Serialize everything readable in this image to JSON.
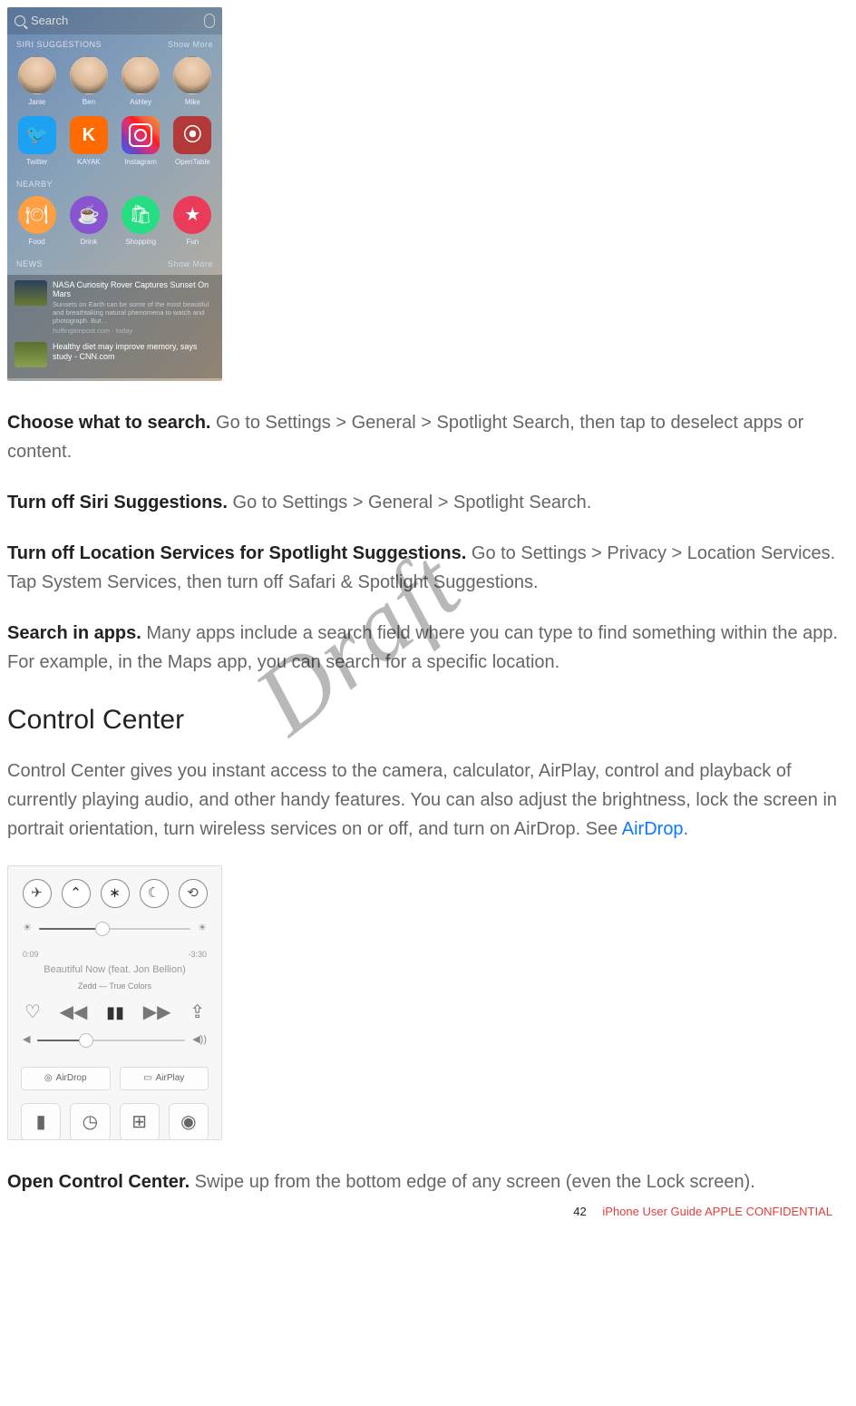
{
  "shot1": {
    "search_placeholder": "Search",
    "section_siri": "SIRI SUGGESTIONS",
    "section_nearby": "NEARBY",
    "section_news": "NEWS",
    "show_more": "Show More",
    "people": [
      "Janie",
      "Ben",
      "Ashley",
      "Mike"
    ],
    "apps": [
      "Twitter",
      "KAYAK",
      "Instagram",
      "OpenTable"
    ],
    "nearby": [
      "Food",
      "Drink",
      "Shopping",
      "Fun"
    ],
    "news1_title": "NASA Curiosity Rover Captures Sunset On Mars",
    "news1_sub": "Sunsets on Earth can be some of the most beautiful and breathtaking natural phenomena to watch and photograph. But…",
    "news1_src": "huffingtonpost.com · today",
    "news2_title": "Healthy diet may improve memory, says study - CNN.com"
  },
  "p1_bold": "Choose what to search.",
  "p1_rest": " Go to Settings > General > Spotlight Search, then tap to deselect apps or content.",
  "p2_bold": "Turn off Siri Suggestions.",
  "p2_rest": " Go to Settings > General > Spotlight Search.",
  "p3_bold": "Turn off Location Services for Spotlight Suggestions.",
  "p3_rest": " Go to Settings > Privacy > Location Services. Tap System Services, then turn off Safari & Spotlight Suggestions.",
  "p4_bold": "Search in apps.",
  "p4_rest": " Many apps include a search field where you can type to find something within the app. For example, in the Maps app, you can search for a specific location.",
  "h2": "Control Center",
  "p5_a": "Control Center gives you instant access to the camera, calculator, AirPlay, control and playback of currently playing audio, and other handy features. You can also adjust the brightness, lock the screen in portrait orientation, turn wireless services on or off, and turn on AirDrop. See ",
  "p5_link": "AirDrop",
  "p5_b": ".",
  "cc": {
    "time_elapsed": "0:09",
    "time_remain": "-3:30",
    "song": "Beautiful Now (feat. Jon Bellion)",
    "album": "Zedd — True Colors",
    "airdrop": "AirDrop",
    "airplay": "AirPlay"
  },
  "p6_bold": "Open Control Center.",
  "p6_rest": " Swipe up from the bottom edge of any screen (even the Lock screen).",
  "watermark": "Draft",
  "footer_page": "42",
  "footer_text": "iPhone User Guide  APPLE CONFIDENTIAL"
}
